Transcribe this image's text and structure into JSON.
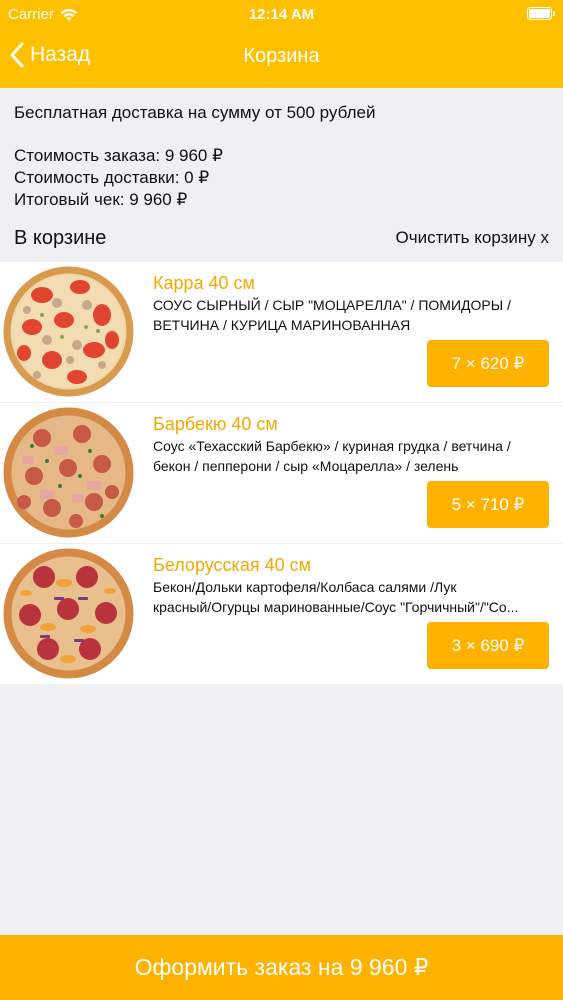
{
  "status_bar": {
    "carrier": "Carrier",
    "time": "12:14 AM",
    "wifi_icon": "wifi-icon",
    "battery_icon": "battery-icon"
  },
  "nav": {
    "back_label": "Назад",
    "back_icon": "chevron-left-icon",
    "title": "Корзина"
  },
  "summary": {
    "free_delivery": "Бесплатная доставка на сумму от 500 рублей",
    "order_cost": "Стоимость заказа: 9 960 ₽",
    "delivery_cost": "Стоимость доставки: 0 ₽",
    "total": "Итоговый чек: 9 960 ₽"
  },
  "cart": {
    "title": "В корзине",
    "clear_label": "Очистить корзину x"
  },
  "items": [
    {
      "name": "Карра 40 см",
      "desc_line1": "СОУС СЫРНЫЙ / СЫР \"МОЦАРЕЛЛА\" / ПОМИДОРЫ /",
      "desc_line2": "ВЕТЧИНА / КУРИЦА МАРИНОВАННАЯ",
      "price": "7 × 620 ₽",
      "image": "pizza-image"
    },
    {
      "name": "Барбекю 40 см",
      "desc_line1": "Соус «Техасский Барбекю» / куриная грудка / ветчина /",
      "desc_line2": "бекон / пепперони / сыр «Моцарелла» / зелень",
      "price": "5 × 710 ₽",
      "image": "pizza-image"
    },
    {
      "name": "Белорусская 40 см",
      "desc_line1": "Бекон/Дольки картофеля/Колбаса салями /Лук",
      "desc_line2": "красный/Огурцы маринованные/Соус \"Горчичный\"/\"Со...",
      "price": "3 × 690 ₽",
      "image": "pizza-image"
    }
  ],
  "checkout": {
    "label": "Оформить заказ на 9 960 ₽"
  },
  "colors": {
    "accent": "#ffc000",
    "button": "#ffb300",
    "item_title": "#f5a800",
    "background": "#efeff4"
  }
}
